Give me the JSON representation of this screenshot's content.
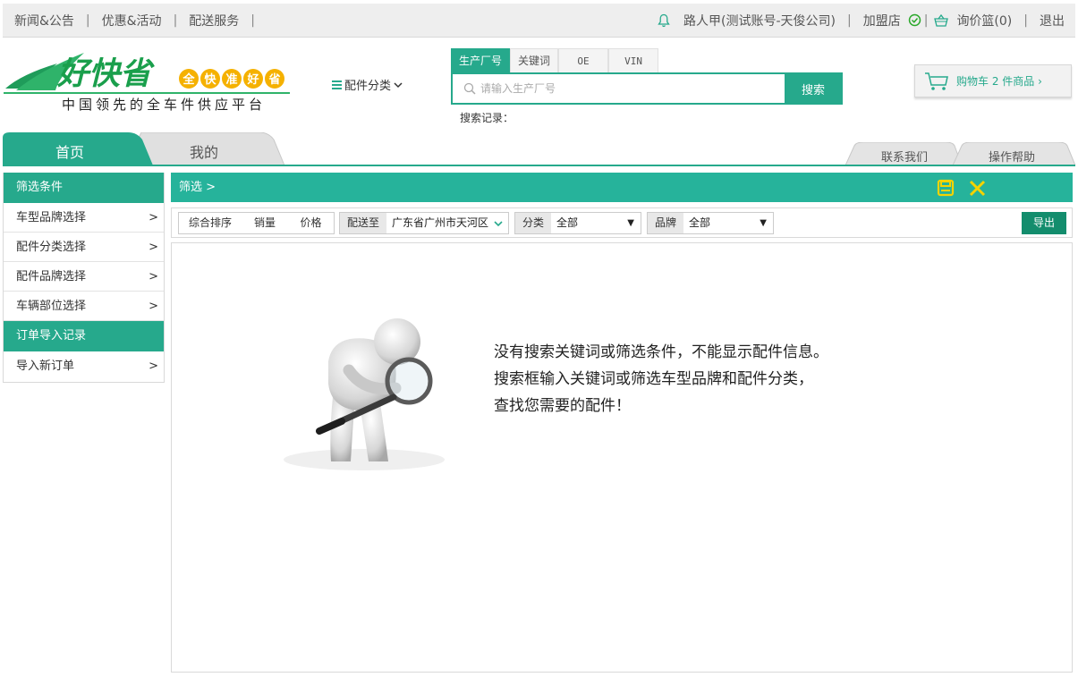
{
  "colors": {
    "brand": "#26a98c",
    "crumb_bg": "#26b39b",
    "accent_yellow": "#f5d300",
    "export": "#138d6d"
  },
  "topbar": {
    "news": "新闻&公告",
    "promo": "优惠&活动",
    "delivery": "配送服务",
    "user": "路人甲(测试账号-天俊公司)",
    "franchise": "加盟店",
    "inquiry": "询价篮(0)",
    "logout": "退出"
  },
  "header": {
    "logo_text": "好快省",
    "logo_badges": [
      "全",
      "快",
      "准",
      "好",
      "省"
    ],
    "slogan": "中国领先的全车件供应平台",
    "category_menu": "配件分类"
  },
  "search": {
    "tabs": [
      "生产厂号",
      "关键词",
      "OE",
      "VIN"
    ],
    "active_tab": 0,
    "placeholder": "请输入生产厂号",
    "button": "搜索",
    "history_label": "搜索记录："
  },
  "cart": {
    "label": "购物车 2 件商品 ›"
  },
  "nav": {
    "home": "首页",
    "mine": "我的",
    "contact": "联系我们",
    "help": "操作帮助"
  },
  "sidebar": {
    "header": "筛选条件",
    "items": [
      {
        "label": "车型品牌选择",
        "arrow": ">"
      },
      {
        "label": "配件分类选择",
        "arrow": ">"
      },
      {
        "label": "配件品牌选择",
        "arrow": ">"
      },
      {
        "label": "车辆部位选择",
        "arrow": ">"
      }
    ],
    "section2": "订单导入记录",
    "items2": [
      {
        "label": "导入新订单",
        "arrow": ">"
      }
    ]
  },
  "breadcrumb": {
    "label": "筛选 >"
  },
  "filters": {
    "sort_default": "综合排序",
    "sort_sales": "销量",
    "sort_price": "价格",
    "ship_label": "配送至",
    "ship_value": "广东省广州市天河区",
    "category_label": "分类",
    "category_value": "全部",
    "brand_label": "品牌",
    "brand_value": "全部",
    "export": "导出"
  },
  "empty_state": {
    "line1": "没有搜索关键词或筛选条件，不能显示配件信息。",
    "line2": "搜索框输入关键词或筛选车型品牌和配件分类，",
    "line3": "查找您需要的配件！"
  }
}
